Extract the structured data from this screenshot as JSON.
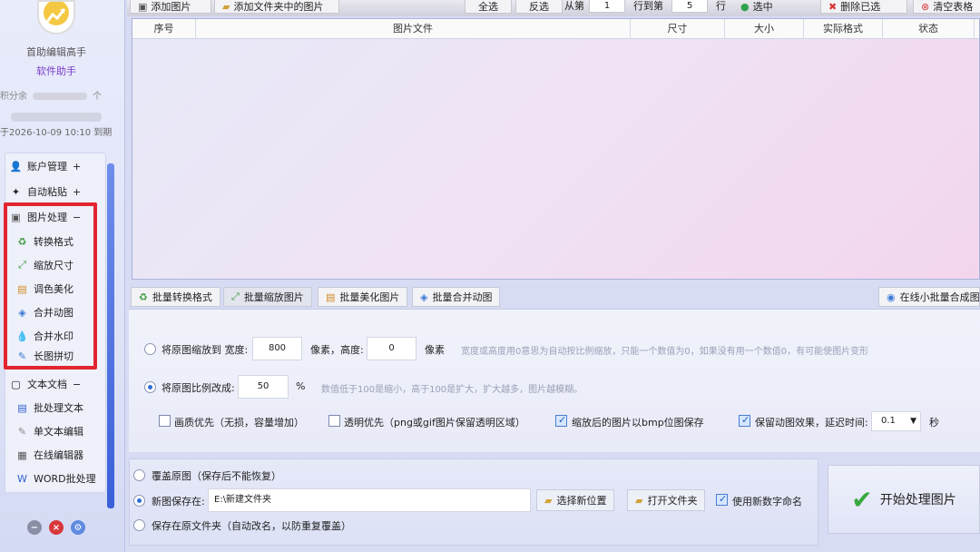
{
  "sidebar": {
    "app_name": "首助编辑高手",
    "app_subtitle": "软件助手",
    "points_label": "积分余",
    "points_unit": "个",
    "expire_text": "于2026-10-09 10:10 到期",
    "menu": [
      {
        "label": "账户管理",
        "suffix": "+",
        "icon": "user-icon"
      },
      {
        "label": "自动粘贴",
        "suffix": "+",
        "icon": "paste-icon"
      },
      {
        "label": "图片处理",
        "suffix": "−",
        "icon": "image-icon"
      },
      {
        "label": "转换格式",
        "icon": "convert-icon"
      },
      {
        "label": "缩放尺寸",
        "icon": "resize-icon"
      },
      {
        "label": "调色美化",
        "icon": "palette-icon"
      },
      {
        "label": "合并动图",
        "icon": "gif-icon"
      },
      {
        "label": "合并水印",
        "icon": "watermark-icon"
      },
      {
        "label": "长图拼切",
        "icon": "longimage-icon"
      },
      {
        "label": "文本文档",
        "suffix": "−",
        "icon": "document-icon"
      },
      {
        "label": "批处理文本",
        "icon": "batch-text-icon"
      },
      {
        "label": "单文本编辑",
        "icon": "edit-icon"
      },
      {
        "label": "在线编辑器",
        "icon": "online-editor-icon"
      },
      {
        "label": "WORD批处理",
        "icon": "word-icon"
      }
    ]
  },
  "toolbar": {
    "add_image": "添加图片",
    "add_folder": "添加文件夹中的图片",
    "select_all": "全选",
    "invert": "反选",
    "from_label": "从第",
    "from_value": "1",
    "to_label": "行到第",
    "to_value": "5",
    "row_label": "行",
    "select_label": "选中",
    "delete_selected": "删除已选",
    "clear_table": "清空表格"
  },
  "table": {
    "columns": [
      "序号",
      "图片文件",
      "尺寸",
      "大小",
      "实际格式",
      "状态"
    ]
  },
  "tabs": [
    {
      "label": "批量转换格式"
    },
    {
      "label": "批量缩放图片"
    },
    {
      "label": "批量美化图片"
    },
    {
      "label": "批量合并动图"
    },
    {
      "label": "在线小批量合成图片"
    }
  ],
  "options": {
    "scale_to_label": "将原图缩放到 宽度:",
    "width_value": "800",
    "px_height_label": "像素，高度:",
    "height_value": "0",
    "px_label": "像素",
    "scale_hint": "宽度或高度用0意思为自动按比例缩放，只能一个数值为0，如果没有用一个数值0，有可能使图片变形",
    "ratio_label": "将原图比例改成:",
    "ratio_value": "50",
    "percent": "%",
    "ratio_hint": "数值低于100是缩小，高于100是扩大，扩大越多，图片越模糊。",
    "quality_first": "画质优先（无损，容量增加）",
    "transparent_first": "透明优先（png或gif图片保留透明区域）",
    "save_bmp": "缩放后的图片以bmp位图保存",
    "keep_anim": "保留动图效果，延迟时间:",
    "delay_value": "0.1",
    "seconds": "秒"
  },
  "save": {
    "overwrite": "覆盖原图（保存后不能恢复）",
    "new_save": "新图保存在:",
    "path_value": "E:\\新建文件夹",
    "choose_location": "选择新位置",
    "open_folder": "打开文件夹",
    "use_numeric": "使用新数字命名",
    "save_original": "保存在原文件夹（自动改名，以防重复覆盖）"
  },
  "start_button": "开始处理图片",
  "colors": {
    "highlight": "#e3252f",
    "accent": "#2c6ed6"
  }
}
